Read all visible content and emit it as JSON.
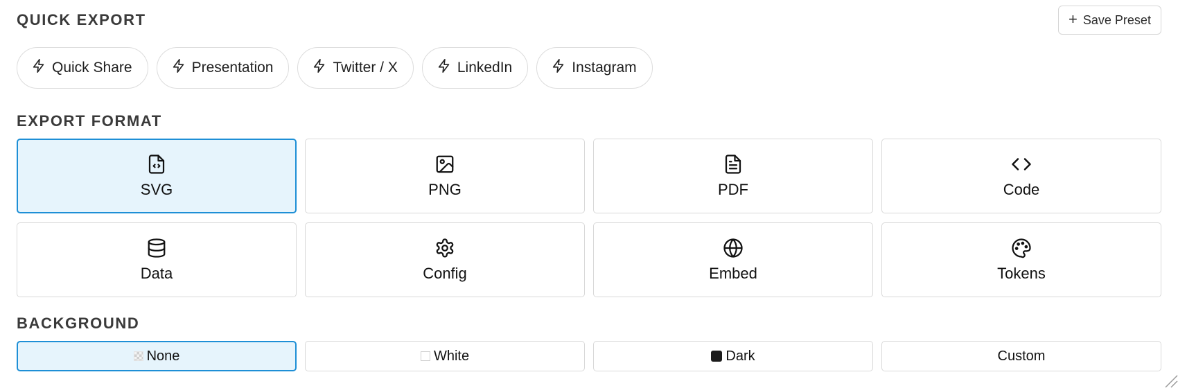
{
  "quick_export": {
    "title": "QUICK EXPORT",
    "save_preset_label": "Save Preset",
    "presets": [
      {
        "label": "Quick Share",
        "icon": "lightning-icon"
      },
      {
        "label": "Presentation",
        "icon": "lightning-icon"
      },
      {
        "label": "Twitter / X",
        "icon": "lightning-icon"
      },
      {
        "label": "LinkedIn",
        "icon": "lightning-icon"
      },
      {
        "label": "Instagram",
        "icon": "lightning-icon"
      }
    ]
  },
  "export_format": {
    "title": "EXPORT FORMAT",
    "selected": "SVG",
    "formats": [
      {
        "label": "SVG",
        "icon": "file-code-icon"
      },
      {
        "label": "PNG",
        "icon": "image-icon"
      },
      {
        "label": "PDF",
        "icon": "file-text-icon"
      },
      {
        "label": "Code",
        "icon": "code-icon"
      },
      {
        "label": "Data",
        "icon": "database-icon"
      },
      {
        "label": "Config",
        "icon": "gear-icon"
      },
      {
        "label": "Embed",
        "icon": "globe-icon"
      },
      {
        "label": "Tokens",
        "icon": "palette-icon"
      }
    ]
  },
  "background": {
    "title": "BACKGROUND",
    "selected": "None",
    "options": [
      {
        "label": "None",
        "swatch": "transparent-swatch"
      },
      {
        "label": "White",
        "swatch": "white-swatch"
      },
      {
        "label": "Dark",
        "swatch": "dark-swatch"
      },
      {
        "label": "Custom",
        "swatch": ""
      }
    ]
  },
  "colors": {
    "accent": "#1e8fd6",
    "selected_bg": "#e6f4fc",
    "border": "#d9d9d9"
  }
}
